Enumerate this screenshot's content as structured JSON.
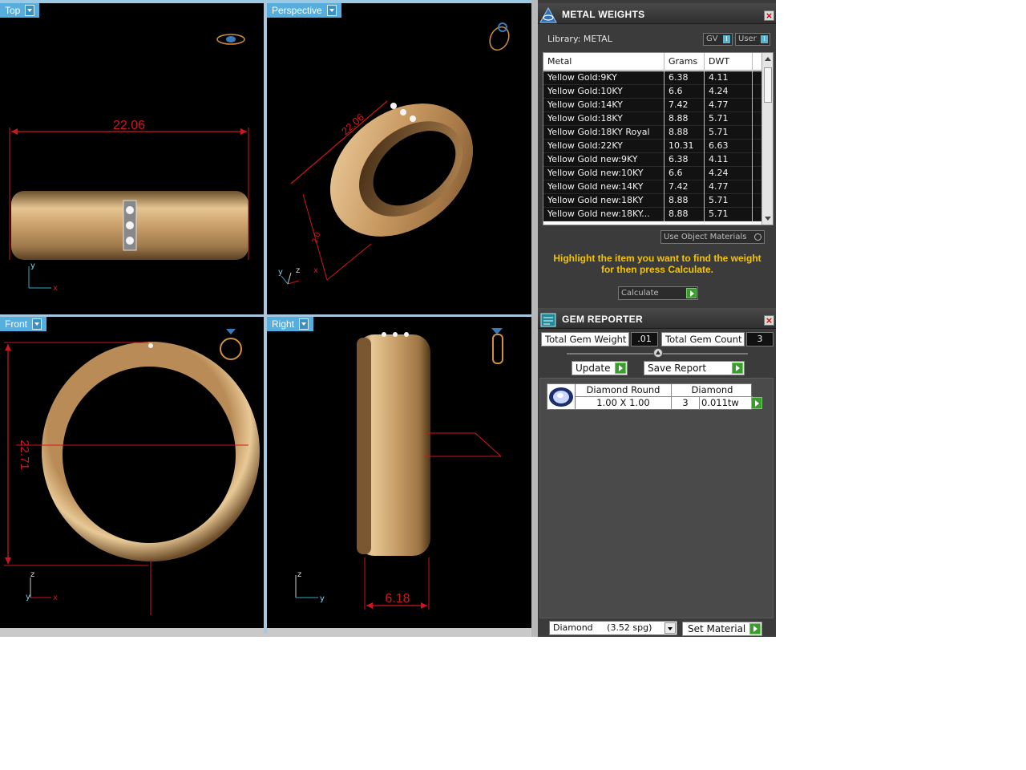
{
  "viewports": {
    "top": {
      "label": "Top",
      "dimension": "22.06"
    },
    "perspective": {
      "label": "Perspective",
      "dimension": "22.06",
      "dimension_small": "2.0"
    },
    "front": {
      "label": "Front",
      "dimension": "22.71"
    },
    "right": {
      "label": "Right",
      "dimension": "6.18"
    },
    "axes": {
      "x": "x",
      "y": "y",
      "z": "z"
    }
  },
  "metal_weights": {
    "title": "METAL WEIGHTS",
    "library_label": "Library: METAL",
    "gv_toggle": "GV",
    "user_toggle": "User",
    "toggle_knob": "I",
    "columns": [
      "Metal",
      "Grams",
      "DWT"
    ],
    "rows": [
      {
        "metal": "Yellow Gold:9KY",
        "grams": "6.38",
        "dwt": "4.11"
      },
      {
        "metal": "Yellow Gold:10KY",
        "grams": "6.6",
        "dwt": "4.24"
      },
      {
        "metal": "Yellow Gold:14KY",
        "grams": "7.42",
        "dwt": "4.77"
      },
      {
        "metal": "Yellow Gold:18KY",
        "grams": "8.88",
        "dwt": "5.71"
      },
      {
        "metal": "Yellow Gold:18KY Royal",
        "grams": "8.88",
        "dwt": "5.71"
      },
      {
        "metal": "Yellow Gold:22KY",
        "grams": "10.31",
        "dwt": "6.63"
      },
      {
        "metal": "Yellow Gold new:9KY",
        "grams": "6.38",
        "dwt": "4.11"
      },
      {
        "metal": "Yellow Gold new:10KY",
        "grams": "6.6",
        "dwt": "4.24"
      },
      {
        "metal": "Yellow Gold new:14KY",
        "grams": "7.42",
        "dwt": "4.77"
      },
      {
        "metal": "Yellow Gold new:18KY",
        "grams": "8.88",
        "dwt": "5.71"
      },
      {
        "metal": "Yellow Gold new:18KY...",
        "grams": "8.88",
        "dwt": "5.71"
      }
    ],
    "use_object_materials": "Use Object Materials",
    "hint": "Highlight the item you want to find the weight for then press Calculate.",
    "calculate_label": "Calculate"
  },
  "gem_reporter": {
    "title": "GEM REPORTER",
    "total_weight_label": "Total Gem Weight",
    "total_weight_value": ".01",
    "total_count_label": "Total Gem Count",
    "total_count_value": "3",
    "update_label": "Update",
    "save_report_label": "Save Report",
    "gems": [
      {
        "shape": "Diamond Round",
        "size": "1.00 X 1.00",
        "count": "3",
        "material": "Diamond",
        "weight": "0.011tw"
      }
    ],
    "material_select": "Diamond     (3.52 spg)",
    "set_material_label": "Set Material"
  },
  "colors": {
    "viewport_bg": "#000000",
    "dimension_red": "#d0161c",
    "gold": "#c9a068",
    "label_blue": "#55aede",
    "hint_yellow": "#f4c400"
  }
}
